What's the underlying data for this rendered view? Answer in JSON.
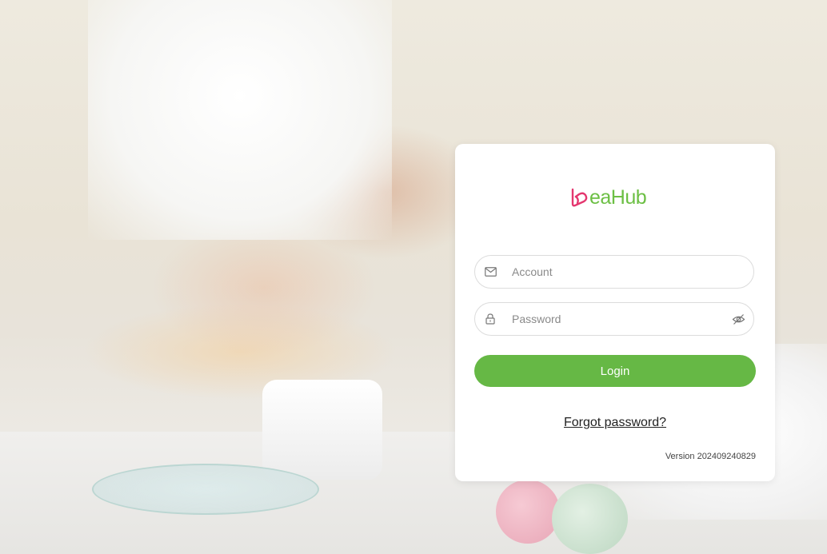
{
  "brand": {
    "logo_text": "eaHub",
    "logo_mark_color": "#e4376f",
    "logo_text_color": "#6cbf44"
  },
  "login_form": {
    "account_placeholder": "Account",
    "account_icon": "mail-icon",
    "password_placeholder": "Password",
    "password_icon": "lock-icon",
    "password_toggle_icon": "eye-off-icon",
    "login_label": "Login",
    "login_color": "#66b845",
    "forgot_label": "Forgot password?",
    "version_text": "Version 202409240829"
  }
}
